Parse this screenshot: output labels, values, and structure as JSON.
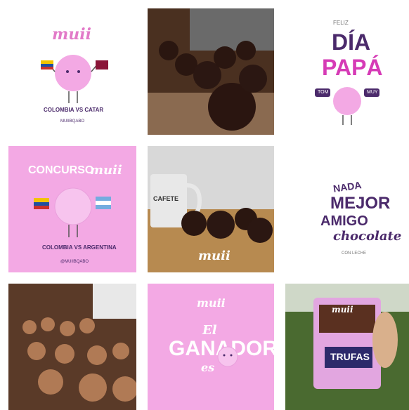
{
  "tiles": {
    "t1": {
      "logo": "muii",
      "line": "COLOMBIA VS CATAR",
      "handle": "MUIIBQABO"
    },
    "t3": {
      "small": "FELIZ",
      "title1": "DÍA",
      "title2": "PAPÁ",
      "tag1": "TOM",
      "tag2": "MUY"
    },
    "t4": {
      "heading": "CONCURSO",
      "logo": "muii",
      "line": "COLOMBIA VS ARGENTINA",
      "handle": "@MUIIBQABO"
    },
    "t5": {
      "mug": "CAFETE",
      "logo": "muii"
    },
    "t6": {
      "w1": "NADA",
      "w2": "MEJOR",
      "w3": "AMIGO",
      "w4": "chocolate",
      "sub": "CON LECHE"
    },
    "t8": {
      "logo": "muii",
      "w1": "El",
      "w2": "GANADOR",
      "w3": "es"
    },
    "t9": {
      "brand": "muii",
      "product": "TRUFAS"
    }
  },
  "colors": {
    "pink": "#f3a9e4",
    "magenta": "#d63bb6",
    "purple": "#4b2a6b",
    "chocolate": "#3a2418",
    "red": "#c9302c"
  }
}
